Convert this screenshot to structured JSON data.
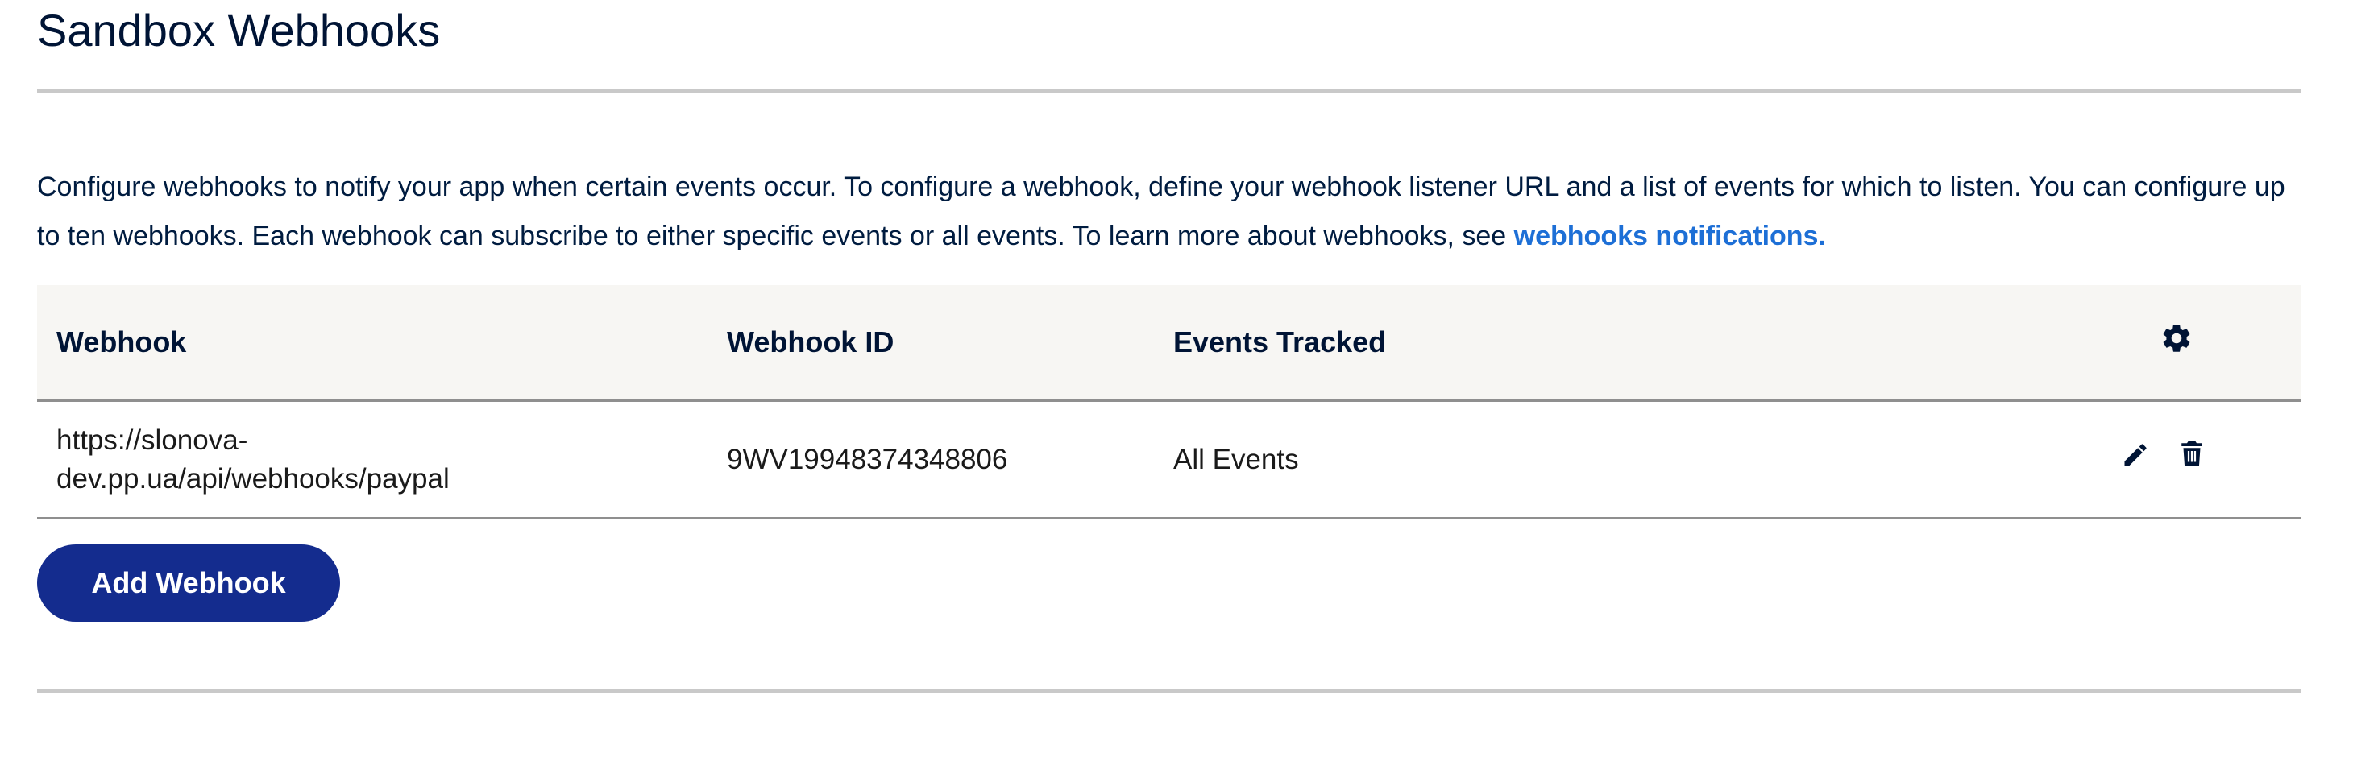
{
  "page": {
    "title": "Sandbox Webhooks"
  },
  "description": {
    "text": "Configure webhooks to notify your app when certain events occur. To configure a webhook, define your webhook listener URL and a list of events for which to listen. You can configure up to ten webhooks. Each webhook can subscribe to either specific events or all events. To learn more about webhooks, see ",
    "link_text": "webhooks notifications."
  },
  "table": {
    "headers": {
      "webhook": "Webhook",
      "webhook_id": "Webhook ID",
      "events_tracked": "Events Tracked",
      "settings_icon": "gear-icon"
    },
    "rows": [
      {
        "webhook": "https://slonova-dev.pp.ua/api/webhooks/paypal",
        "webhook_id": "9WV19948374348806",
        "events_tracked": "All Events",
        "actions": [
          "pencil-icon",
          "trash-icon"
        ]
      }
    ]
  },
  "actions": {
    "add_label": "Add Webhook"
  },
  "colors": {
    "text": "#001435",
    "link": "#1d6fd6",
    "button_bg": "#142c8e",
    "header_bg": "#f7f6f3",
    "divider": "#c9c9c9"
  }
}
